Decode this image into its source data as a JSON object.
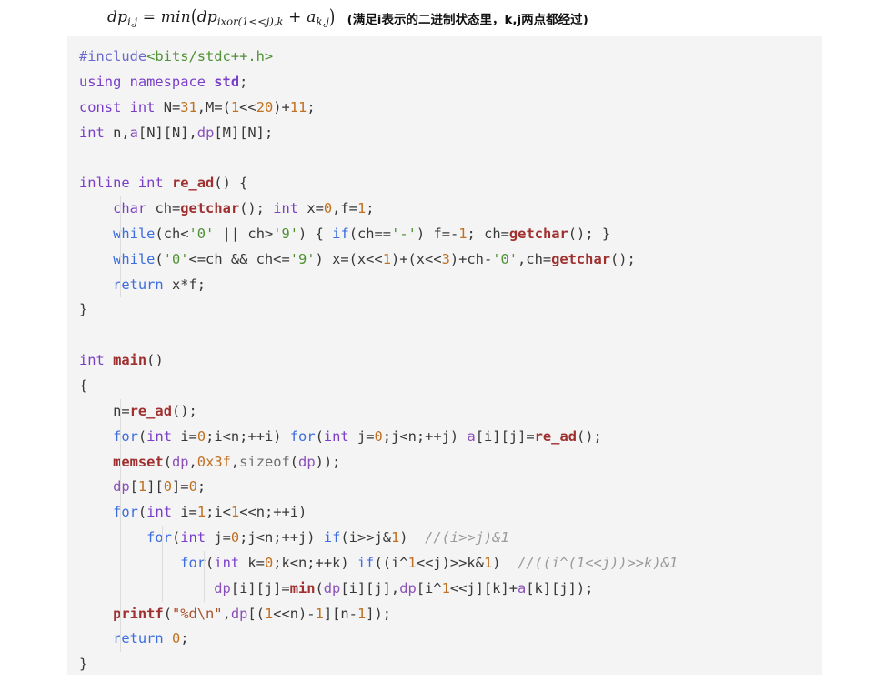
{
  "formula": {
    "lhs": "dp",
    "lhs_sub": "i,j",
    "equals": "=",
    "fn": "min",
    "arg1": "dp",
    "arg1_sub_main": "ixor(1<<j),k",
    "plus": "+",
    "arg2": "a",
    "arg2_sub": "k,j",
    "full_text": "dp_{i,j} = min(dp_{ixor(1<<j),k} + a_{k,j})",
    "note": "(满足i表示的二进制状态里，k,j两点都经过)"
  },
  "code": {
    "language": "cpp",
    "background_color": "#f4f4f4",
    "text_color": "#383838",
    "colors": {
      "keyword_type": "#7a3ec8",
      "keyword_control": "#3b6ce0",
      "preprocessor": "#6a6acb",
      "include_path": "#4f9134",
      "function": "#a03030",
      "number": "#c07020",
      "string": "#a8522a",
      "comment": "#9a9a9a",
      "identifier": "#8a4fb8",
      "indent_guide": "#dcdcdc"
    },
    "lines": [
      "#include<bits/stdc++.h>",
      "using namespace std;",
      "const int N=31,M=(1<<20)+11;",
      "int n,a[N][N],dp[M][N];",
      "",
      "inline int re_ad() {",
      "    char ch=getchar(); int x=0,f=1;",
      "    while(ch<'0' || ch>'9') { if(ch=='-') f=-1; ch=getchar(); }",
      "    while('0'<=ch && ch<='9') x=(x<<1)+(x<<3)+ch-'0',ch=getchar();",
      "    return x*f;",
      "}",
      "",
      "int main()",
      "{",
      "    n=re_ad();",
      "    for(int i=0;i<n;++i) for(int j=0;j<n;++j) a[i][j]=re_ad();",
      "    memset(dp,0x3f,sizeof(dp));",
      "    dp[1][0]=0;",
      "    for(int i=1;i<1<<n;++i)",
      "        for(int j=0;j<n;++j) if(i>>j&1)  //(i>>j)&1",
      "            for(int k=0;k<n;++k) if((i^1<<j)>>k&1)  //((i^(1<<j))>>k)&1",
      "                dp[i][j]=min(dp[i][j],dp[i^1<<j][k]+a[k][j]);",
      "    printf(\"%d\\n\",dp[(1<<n)-1][n-1]);",
      "    return 0;",
      "}"
    ]
  }
}
